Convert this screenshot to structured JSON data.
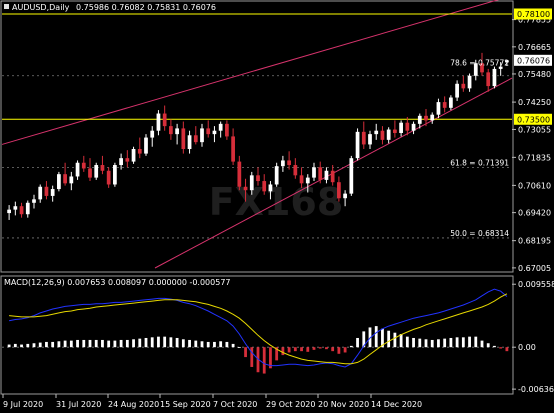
{
  "chart_data": [
    {
      "type": "candlestick",
      "header": {
        "symbol": "AUDUSD,Daily",
        "ohlc": "0.75986 0.76082 0.75831 0.76076"
      },
      "ylim": [
        0.67,
        0.781
      ],
      "y_ticks": [
        "0.77855",
        "0.76665",
        "0.75480",
        "0.74250",
        "0.73055",
        "0.71835",
        "0.70610",
        "0.69420",
        "0.68195",
        "0.67005"
      ],
      "x_ticks": [
        "9 Jul 2020",
        "31 Jul 2020",
        "24 Aug 2020",
        "15 Sep 2020",
        "7 Oct 2020",
        "29 Oct 2020",
        "20 Nov 2020",
        "14 Dec 2020"
      ],
      "price_tags": [
        {
          "label": "0.78100",
          "value": 0.781,
          "color": "#ffff00"
        },
        {
          "label": "0.76076",
          "value": 0.76076,
          "color": "#ffffff"
        },
        {
          "label": "0.73500",
          "value": 0.735,
          "color": "#ffff00"
        }
      ],
      "horizontal_lines": [
        {
          "value": 0.781,
          "color": "#ffff00",
          "style": "solid"
        },
        {
          "value": 0.735,
          "color": "#ffff00",
          "style": "solid"
        }
      ],
      "fibonacci_levels": [
        {
          "label": "78.6 = 0.75772",
          "value": 0.75772
        },
        {
          "label": "61.8 = 0.71391",
          "value": 0.71391
        },
        {
          "label": "50.0 = 0.68314",
          "value": 0.68314
        }
      ],
      "trend_channel": {
        "color": "#d6336c",
        "upper": [
          [
            0,
            0.724
          ],
          [
            100,
            0.789
          ]
        ],
        "lower": [
          [
            30,
            0.67
          ],
          [
            100,
            0.753
          ]
        ]
      },
      "candles": [
        [
          0.694,
          0.6975,
          0.691,
          0.6955
        ],
        [
          0.6955,
          0.699,
          0.693,
          0.697
        ],
        [
          0.697,
          0.6985,
          0.692,
          0.6935
        ],
        [
          0.6935,
          0.6995,
          0.692,
          0.6985
        ],
        [
          0.6985,
          0.702,
          0.696,
          0.7
        ],
        [
          0.7,
          0.7065,
          0.6985,
          0.7055
        ],
        [
          0.7055,
          0.708,
          0.7,
          0.7015
        ],
        [
          0.7015,
          0.706,
          0.699,
          0.7045
        ],
        [
          0.7045,
          0.712,
          0.7035,
          0.711
        ],
        [
          0.711,
          0.716,
          0.706,
          0.707
        ],
        [
          0.707,
          0.712,
          0.704,
          0.71
        ],
        [
          0.71,
          0.717,
          0.7085,
          0.716
        ],
        [
          0.716,
          0.719,
          0.712,
          0.7135
        ],
        [
          0.7135,
          0.718,
          0.708,
          0.7095
        ],
        [
          0.7095,
          0.716,
          0.7085,
          0.715
        ],
        [
          0.715,
          0.719,
          0.711,
          0.7125
        ],
        [
          0.7125,
          0.714,
          0.705,
          0.7065
        ],
        [
          0.7065,
          0.716,
          0.7055,
          0.715
        ],
        [
          0.715,
          0.72,
          0.713,
          0.718
        ],
        [
          0.718,
          0.7215,
          0.714,
          0.7165
        ],
        [
          0.7165,
          0.723,
          0.7155,
          0.722
        ],
        [
          0.722,
          0.727,
          0.718,
          0.72
        ],
        [
          0.72,
          0.7285,
          0.719,
          0.727
        ],
        [
          0.727,
          0.732,
          0.723,
          0.73
        ],
        [
          0.73,
          0.739,
          0.728,
          0.7375
        ],
        [
          0.7375,
          0.741,
          0.73,
          0.732
        ],
        [
          0.732,
          0.735,
          0.726,
          0.7285
        ],
        [
          0.7285,
          0.733,
          0.724,
          0.731
        ],
        [
          0.731,
          0.734,
          0.72,
          0.722
        ],
        [
          0.722,
          0.73,
          0.72,
          0.728
        ],
        [
          0.728,
          0.732,
          0.724,
          0.725
        ],
        [
          0.725,
          0.733,
          0.723,
          0.731
        ],
        [
          0.731,
          0.7345,
          0.727,
          0.7285
        ],
        [
          0.7285,
          0.732,
          0.725,
          0.73
        ],
        [
          0.73,
          0.734,
          0.727,
          0.733
        ],
        [
          0.733,
          0.7345,
          0.726,
          0.7275
        ],
        [
          0.7275,
          0.731,
          0.715,
          0.7165
        ],
        [
          0.7165,
          0.719,
          0.704,
          0.7055
        ],
        [
          0.7055,
          0.709,
          0.699,
          0.704
        ],
        [
          0.704,
          0.712,
          0.702,
          0.7105
        ],
        [
          0.7105,
          0.714,
          0.706,
          0.708
        ],
        [
          0.708,
          0.711,
          0.702,
          0.7035
        ],
        [
          0.7035,
          0.708,
          0.7,
          0.7065
        ],
        [
          0.7065,
          0.716,
          0.7055,
          0.7145
        ],
        [
          0.7145,
          0.719,
          0.712,
          0.717
        ],
        [
          0.717,
          0.721,
          0.713,
          0.715
        ],
        [
          0.715,
          0.718,
          0.709,
          0.7105
        ],
        [
          0.7105,
          0.714,
          0.705,
          0.707
        ],
        [
          0.707,
          0.711,
          0.703,
          0.7095
        ],
        [
          0.7095,
          0.716,
          0.708,
          0.714
        ],
        [
          0.714,
          0.7165,
          0.707,
          0.7085
        ],
        [
          0.7085,
          0.714,
          0.707,
          0.7125
        ],
        [
          0.7125,
          0.715,
          0.706,
          0.7075
        ],
        [
          0.7075,
          0.71,
          0.699,
          0.7005
        ],
        [
          0.7005,
          0.704,
          0.697,
          0.7025
        ],
        [
          0.7025,
          0.719,
          0.7015,
          0.718
        ],
        [
          0.718,
          0.731,
          0.717,
          0.7295
        ],
        [
          0.7295,
          0.734,
          0.722,
          0.724
        ],
        [
          0.724,
          0.73,
          0.722,
          0.7285
        ],
        [
          0.7285,
          0.733,
          0.726,
          0.73
        ],
        [
          0.73,
          0.732,
          0.724,
          0.726
        ],
        [
          0.726,
          0.7315,
          0.7245,
          0.7305
        ],
        [
          0.7305,
          0.7345,
          0.727,
          0.729
        ],
        [
          0.729,
          0.7345,
          0.7275,
          0.7335
        ],
        [
          0.7335,
          0.736,
          0.728,
          0.73
        ],
        [
          0.73,
          0.734,
          0.7285,
          0.733
        ],
        [
          0.733,
          0.7375,
          0.731,
          0.7365
        ],
        [
          0.7365,
          0.7395,
          0.732,
          0.7345
        ],
        [
          0.7345,
          0.738,
          0.733,
          0.737
        ],
        [
          0.737,
          0.744,
          0.7355,
          0.7425
        ],
        [
          0.7425,
          0.745,
          0.738,
          0.74
        ],
        [
          0.74,
          0.7455,
          0.739,
          0.7445
        ],
        [
          0.7445,
          0.752,
          0.743,
          0.7505
        ],
        [
          0.7505,
          0.754,
          0.747,
          0.7485
        ],
        [
          0.7485,
          0.755,
          0.747,
          0.754
        ],
        [
          0.754,
          0.761,
          0.752,
          0.7595
        ],
        [
          0.7595,
          0.764,
          0.754,
          0.7555
        ],
        [
          0.7555,
          0.757,
          0.747,
          0.7495
        ],
        [
          0.7495,
          0.758,
          0.7485,
          0.757
        ],
        [
          0.757,
          0.76,
          0.754,
          0.758
        ],
        [
          0.75986,
          0.76082,
          0.75831,
          0.76076
        ]
      ],
      "watermark": "FX168"
    },
    {
      "type": "macd",
      "label": "MACD(12,26,9) 0.007653 0.008097 0.000000 -0.000577",
      "ylim": [
        -0.0068,
        0.0102
      ],
      "y_ticks": [
        "0.009558",
        "0.00",
        "-0.006362"
      ],
      "histogram": [
        0.0004,
        0.0005,
        0.0004,
        0.0005,
        0.0006,
        0.0007,
        0.0008,
        0.0008,
        0.0009,
        0.001,
        0.001,
        0.0011,
        0.0011,
        0.0011,
        0.0011,
        0.0011,
        0.001,
        0.001,
        0.0011,
        0.0011,
        0.0012,
        0.0013,
        0.0014,
        0.0015,
        0.0016,
        0.0016,
        0.0015,
        0.0014,
        0.0012,
        0.0011,
        0.001,
        0.0009,
        0.0008,
        0.0008,
        0.0009,
        0.0008,
        0.0005,
        0.0,
        -0.0015,
        -0.003,
        -0.0038,
        -0.004,
        -0.0032,
        -0.002,
        -0.0012,
        -0.0008,
        -0.0006,
        -0.0006,
        -0.0007,
        -0.0004,
        -0.0002,
        -0.0003,
        -0.0006,
        -0.001,
        -0.0008,
        0.0002,
        0.0014,
        0.0024,
        0.003,
        0.0032,
        0.0028,
        0.0025,
        0.0022,
        0.002,
        0.0016,
        0.0014,
        0.0013,
        0.0012,
        0.0011,
        0.0012,
        0.0013,
        0.0014,
        0.0015,
        0.0015,
        0.0016,
        0.0016,
        0.001,
        0.0006,
        0.0002,
        -0.0002,
        -0.0006
      ],
      "macd_line": [
        0.004,
        0.0042,
        0.0043,
        0.0045,
        0.0048,
        0.0052,
        0.0055,
        0.0058,
        0.006,
        0.0062,
        0.0063,
        0.0064,
        0.0065,
        0.0065,
        0.0066,
        0.0066,
        0.0067,
        0.0068,
        0.0068,
        0.0069,
        0.007,
        0.0071,
        0.0072,
        0.0073,
        0.0074,
        0.0074,
        0.0073,
        0.0071,
        0.0068,
        0.0066,
        0.0063,
        0.0059,
        0.0055,
        0.005,
        0.0045,
        0.004,
        0.0032,
        0.002,
        0.0005,
        -0.0008,
        -0.0018,
        -0.0025,
        -0.0028,
        -0.0028,
        -0.0027,
        -0.0026,
        -0.0026,
        -0.0027,
        -0.0028,
        -0.0027,
        -0.0025,
        -0.0024,
        -0.0025,
        -0.0028,
        -0.003,
        -0.0025,
        -0.0012,
        0.0002,
        0.0014,
        0.0022,
        0.0028,
        0.0032,
        0.0035,
        0.0038,
        0.0041,
        0.0044,
        0.0046,
        0.0048,
        0.005,
        0.0052,
        0.0055,
        0.0058,
        0.0061,
        0.0064,
        0.0068,
        0.0072,
        0.0078,
        0.0084,
        0.0088,
        0.0085,
        0.0077
      ],
      "signal_line": [
        0.0048,
        0.0047,
        0.0046,
        0.0046,
        0.0046,
        0.0047,
        0.0048,
        0.005,
        0.0052,
        0.0054,
        0.0055,
        0.0057,
        0.0058,
        0.0059,
        0.0061,
        0.0062,
        0.0063,
        0.0064,
        0.0065,
        0.0066,
        0.0067,
        0.0068,
        0.0069,
        0.007,
        0.0071,
        0.0072,
        0.0072,
        0.0072,
        0.0071,
        0.007,
        0.0069,
        0.0067,
        0.0065,
        0.0062,
        0.0059,
        0.0055,
        0.005,
        0.0044,
        0.0036,
        0.0027,
        0.0018,
        0.001,
        0.0003,
        -0.0003,
        -0.0008,
        -0.0012,
        -0.0015,
        -0.0018,
        -0.002,
        -0.0021,
        -0.0022,
        -0.0023,
        -0.0023,
        -0.0024,
        -0.0025,
        -0.0025,
        -0.0023,
        -0.0018,
        -0.0011,
        -0.0004,
        0.0003,
        0.0009,
        0.0014,
        0.0019,
        0.0023,
        0.0027,
        0.003,
        0.0034,
        0.0037,
        0.004,
        0.0043,
        0.0046,
        0.0049,
        0.0052,
        0.0055,
        0.0058,
        0.0061,
        0.0065,
        0.007,
        0.0076,
        0.0081
      ]
    }
  ],
  "colors": {
    "background": "#000000",
    "bull_candle": "#ffffff",
    "bear_candle": "#d62e3a",
    "macd_line": "#2233ff",
    "signal_line": "#e6d800",
    "macd_hist_pos": "#ffffff",
    "macd_hist_neg": "#d62e3a",
    "grid": "#7a7a7a",
    "trend_channel": "#d6336c"
  }
}
